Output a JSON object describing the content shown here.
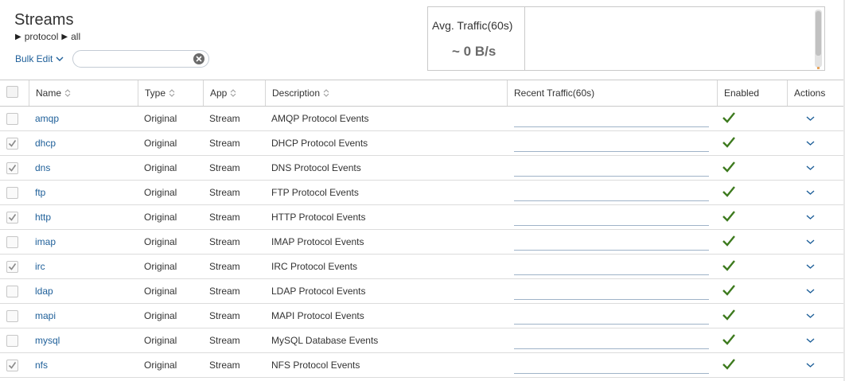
{
  "page": {
    "title": "Streams",
    "breadcrumb": [
      "protocol",
      "all"
    ]
  },
  "toolbar": {
    "bulk_edit_label": "Bulk Edit",
    "search_value": "",
    "search_placeholder": ""
  },
  "traffic": {
    "label": "Avg. Traffic(60s)",
    "value": "~ 0 B/s"
  },
  "table": {
    "columns": [
      "Name",
      "Type",
      "App",
      "Description",
      "Recent Traffic(60s)",
      "Enabled",
      "Actions"
    ],
    "rows": [
      {
        "checked": false,
        "name": "amqp",
        "type": "Original",
        "app": "Stream",
        "description": "AMQP Protocol Events",
        "enabled": true
      },
      {
        "checked": true,
        "name": "dhcp",
        "type": "Original",
        "app": "Stream",
        "description": "DHCP Protocol Events",
        "enabled": true
      },
      {
        "checked": true,
        "name": "dns",
        "type": "Original",
        "app": "Stream",
        "description": "DNS Protocol Events",
        "enabled": true
      },
      {
        "checked": false,
        "name": "ftp",
        "type": "Original",
        "app": "Stream",
        "description": "FTP Protocol Events",
        "enabled": true
      },
      {
        "checked": true,
        "name": "http",
        "type": "Original",
        "app": "Stream",
        "description": "HTTP Protocol Events",
        "enabled": true
      },
      {
        "checked": false,
        "name": "imap",
        "type": "Original",
        "app": "Stream",
        "description": "IMAP Protocol Events",
        "enabled": true
      },
      {
        "checked": true,
        "name": "irc",
        "type": "Original",
        "app": "Stream",
        "description": "IRC Protocol Events",
        "enabled": true
      },
      {
        "checked": false,
        "name": "ldap",
        "type": "Original",
        "app": "Stream",
        "description": "LDAP Protocol Events",
        "enabled": true
      },
      {
        "checked": false,
        "name": "mapi",
        "type": "Original",
        "app": "Stream",
        "description": "MAPI Protocol Events",
        "enabled": true
      },
      {
        "checked": false,
        "name": "mysql",
        "type": "Original",
        "app": "Stream",
        "description": "MySQL Database Events",
        "enabled": true
      },
      {
        "checked": true,
        "name": "nfs",
        "type": "Original",
        "app": "Stream",
        "description": "NFS Protocol Events",
        "enabled": true
      }
    ]
  },
  "colors": {
    "link": "#1e5f99",
    "enabled_check": "#3d7a1e",
    "border": "#c9c9c9"
  }
}
